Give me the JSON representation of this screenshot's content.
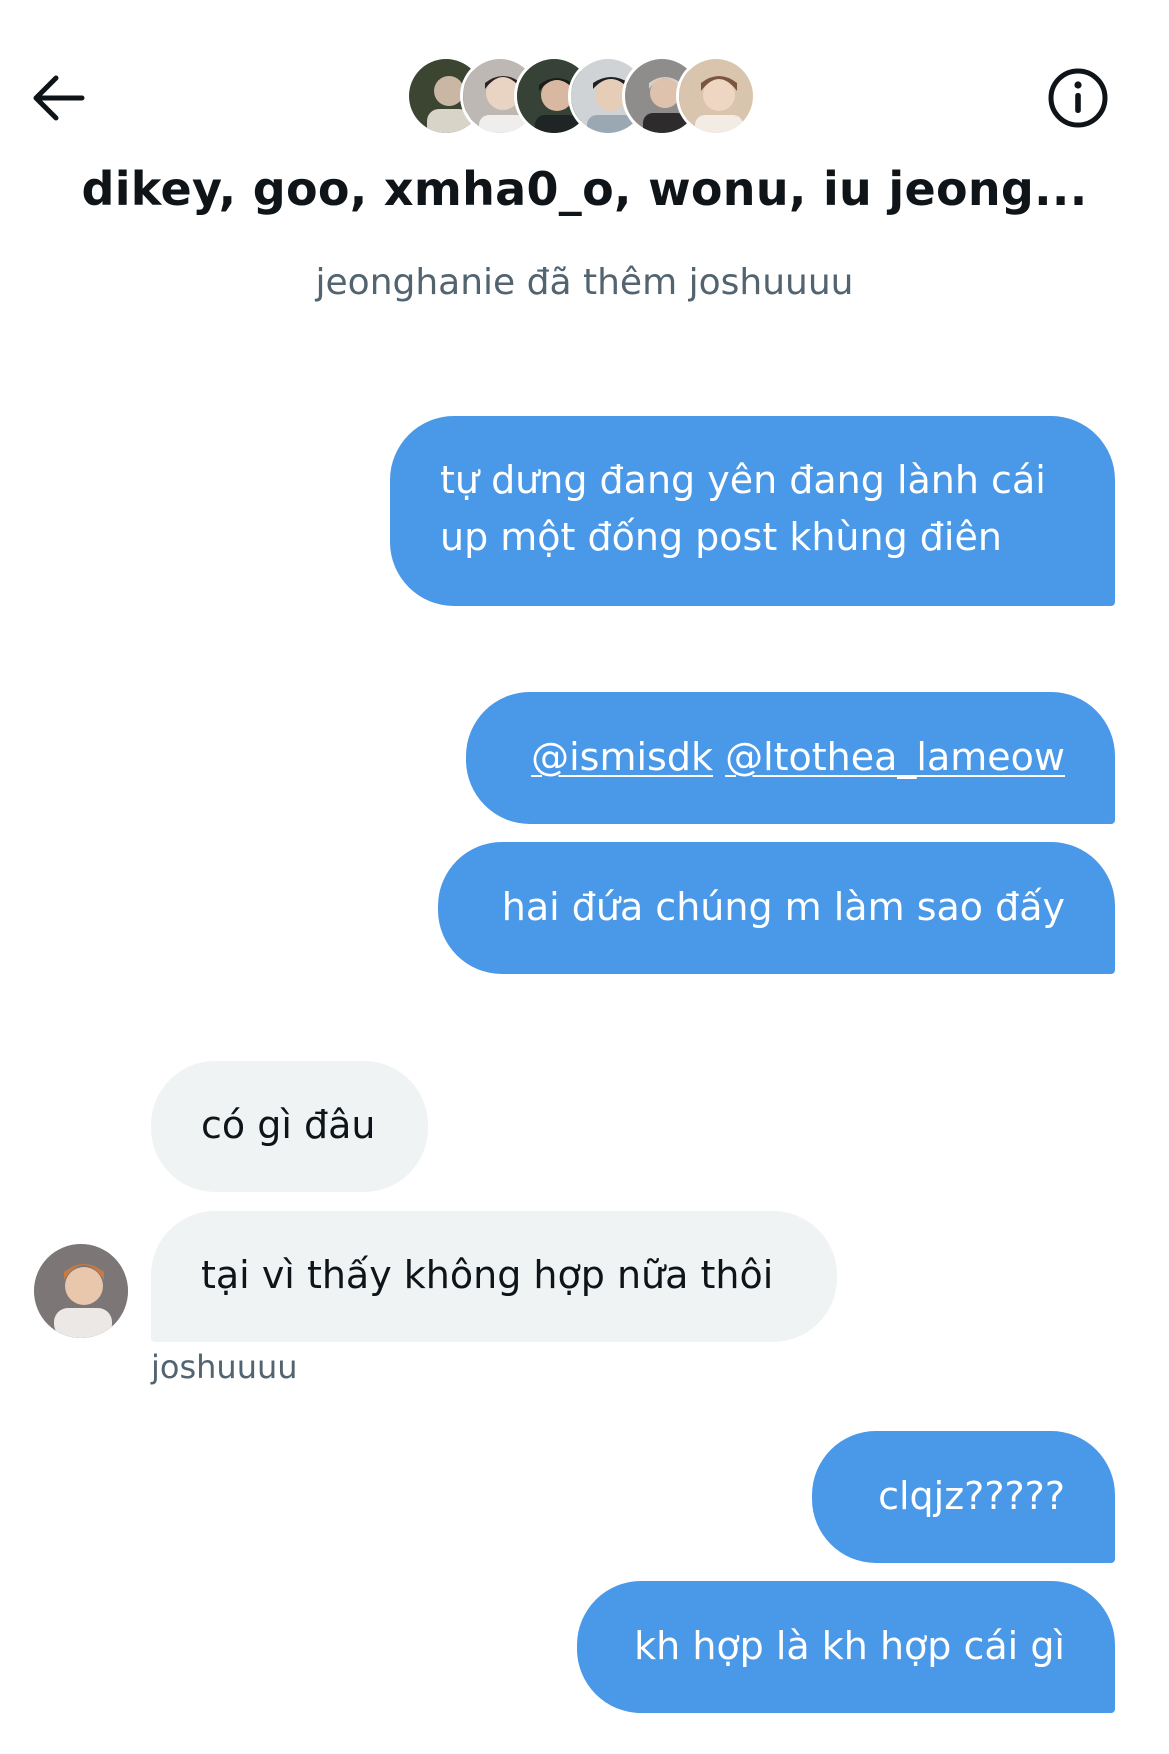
{
  "header": {
    "title": "dikey, goo, xmha0_o, wonu, iu jeong...",
    "back_icon": "arrow-left-icon",
    "info_icon": "info-circle-icon",
    "avatars_count_shown": 6
  },
  "system_message": "jeonghanie đã thêm joshuuuu",
  "messages": [
    {
      "side": "out",
      "lines": [
        "tự dưng đang yên đang lành cái",
        "up một đống post khùng điên"
      ]
    },
    {
      "side": "out",
      "mentions": [
        "@ismisdk",
        "@ltothea_lameow"
      ]
    },
    {
      "side": "out",
      "text": "hai đứa chúng m làm sao đấy"
    },
    {
      "side": "in",
      "text": "có gì đâu"
    },
    {
      "side": "in",
      "text": "tại vì thấy không hợp nữa thôi",
      "sender": "joshuuuu"
    },
    {
      "side": "out",
      "text": "clqjz?????"
    },
    {
      "side": "out",
      "text": "kh hợp là kh hợp cái gì"
    }
  ],
  "colors": {
    "outgoing_bubble": "#4a98e8",
    "incoming_bubble": "#eff3f4",
    "primary_text": "#0f1419",
    "secondary_text": "#536471"
  }
}
